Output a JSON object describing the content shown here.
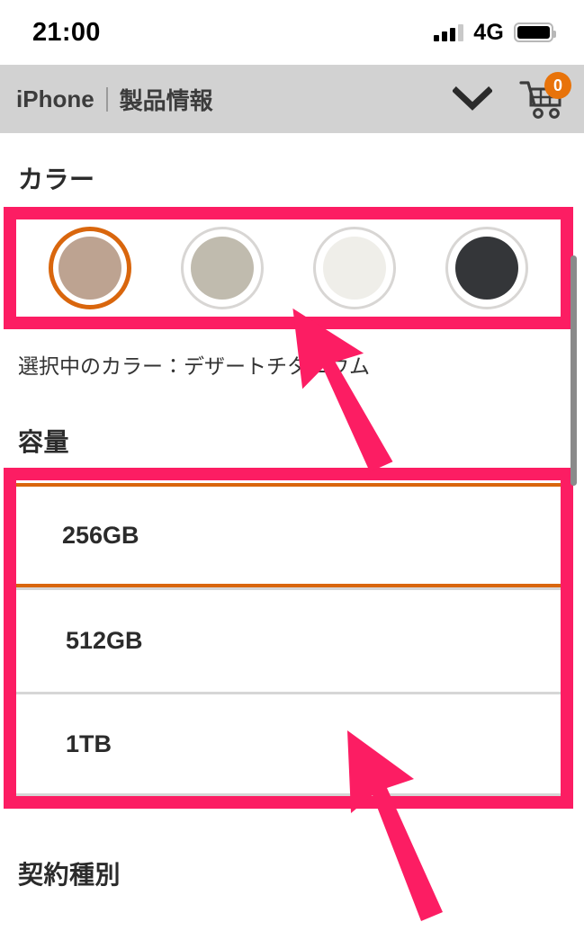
{
  "status_bar": {
    "time": "21:00",
    "network": "4G",
    "signal_icon": "signal-bars-icon",
    "battery_icon": "battery-full-icon"
  },
  "header": {
    "breadcrumb_root": "iPhone",
    "breadcrumb_current": "製品情報",
    "chevron_icon": "chevron-down-icon",
    "cart_icon": "shopping-cart-icon",
    "cart_count": "0",
    "cart_badge_color": "#e8730a",
    "background_color": "#d2d2d2"
  },
  "color_section": {
    "title": "カラー",
    "selected_label": "選択中のカラー：デザートチタニウム",
    "swatches": [
      {
        "name": "desert-titanium",
        "color": "#bda391",
        "selected": true
      },
      {
        "name": "natural-titanium",
        "color": "#c0bbae",
        "selected": false
      },
      {
        "name": "white-titanium",
        "color": "#efeee9",
        "selected": false
      },
      {
        "name": "black-titanium",
        "color": "#343639",
        "selected": false
      }
    ]
  },
  "capacity_section": {
    "title": "容量",
    "options": [
      {
        "label": "256GB",
        "selected": true
      },
      {
        "label": "512GB",
        "selected": false
      },
      {
        "label": "1TB",
        "selected": false
      }
    ]
  },
  "contract_section": {
    "title": "契約種別"
  },
  "annotations": {
    "highlight_color": "#fc1d63",
    "selection_color": "#d9660d",
    "arrow_1_name": "pointer-arrow-color",
    "arrow_2_name": "pointer-arrow-capacity"
  }
}
